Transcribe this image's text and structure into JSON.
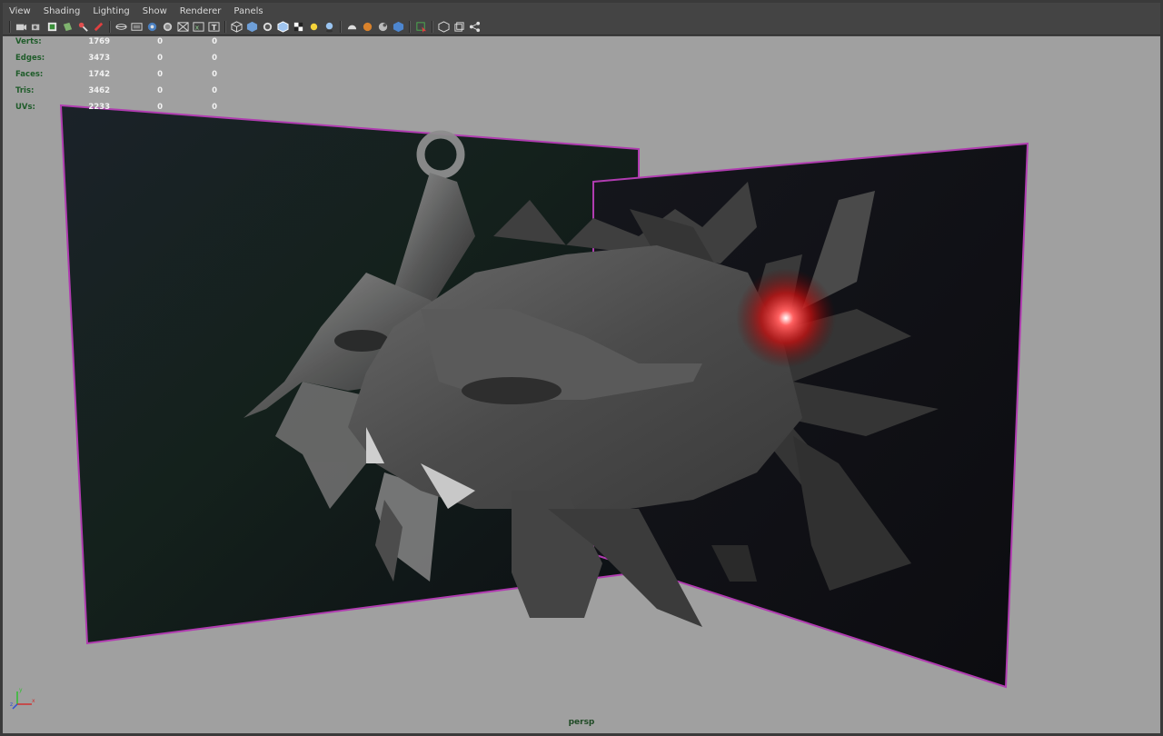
{
  "menu": {
    "items": [
      "View",
      "Shading",
      "Lighting",
      "Show",
      "Renderer",
      "Panels"
    ]
  },
  "toolbar": {
    "icons": [
      "select-camera-icon",
      "camera-attributes-icon",
      "bookmarks-icon",
      "image-plane-icon",
      "2d-pan-zoom-icon",
      "grease-pencil-icon",
      "grid-icon",
      "film-gate-icon",
      "resolution-gate-icon",
      "gate-mask-icon",
      "field-chart-icon",
      "safe-action-icon",
      "safe-title-icon",
      "wireframe-icon",
      "smooth-shade-icon",
      "flat-shade-icon",
      "bounding-box-icon",
      "textured-icon",
      "use-lights-icon",
      "shadows-icon",
      "screen-space-ao-icon",
      "motion-blur-icon",
      "multisample-aa-icon",
      "depth-of-field-icon",
      "isolate-select-icon",
      "xray-icon",
      "xray-joints-icon",
      "xray-components-icon"
    ]
  },
  "hud": {
    "rows": [
      {
        "label": "Verts:",
        "v1": "1769",
        "v2": "0",
        "v3": "0"
      },
      {
        "label": "Edges:",
        "v1": "3473",
        "v2": "0",
        "v3": "0"
      },
      {
        "label": "Faces:",
        "v1": "1742",
        "v2": "0",
        "v3": "0"
      },
      {
        "label": "Tris:",
        "v1": "3462",
        "v2": "0",
        "v3": "0"
      },
      {
        "label": "UVs:",
        "v1": "2233",
        "v2": "0",
        "v3": "0"
      }
    ]
  },
  "viewport": {
    "camera": "persp",
    "background_color": "#a0a0a0",
    "image_plane_border_color": "#c040c0",
    "eye_glow_color": "#ff2020"
  },
  "axis": {
    "x": "x",
    "y": "y",
    "z": "z"
  }
}
